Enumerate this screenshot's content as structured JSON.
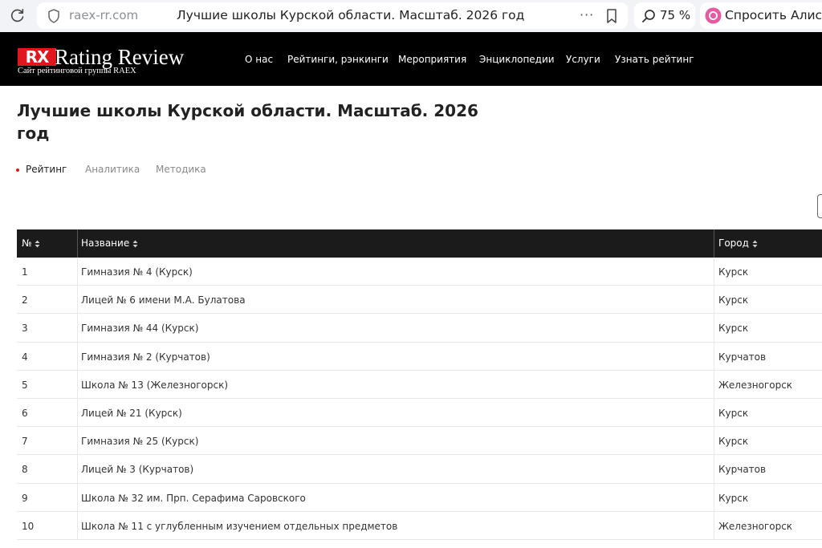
{
  "browser": {
    "url": "raex-rr.com",
    "tab_title": "Лучшие школы Курской области. Масштаб. 2026 год",
    "more_label": "···",
    "zoom": "75 %",
    "alice_label": "Спросить Алису"
  },
  "site": {
    "logo_mark": "RX",
    "logo_name": "Rating Review",
    "logo_subtitle": "Сайт рейтинговой группы RAEX",
    "nav": [
      "О нас",
      "Рейтинги, рэнкинги",
      "Мероприятия",
      "Энциклопедии",
      "Услуги",
      "Узнать рейтинг"
    ]
  },
  "page": {
    "title_line1": "Лучшие школы Курской области. Масштаб. 2026",
    "title_line2": "год",
    "tabs": [
      "Рейтинг",
      "Аналитика",
      "Методика"
    ]
  },
  "table": {
    "columns": [
      "№",
      "Название",
      "Город"
    ],
    "rows": [
      [
        "1",
        "Гимназия № 4 (Курск)",
        "Курск"
      ],
      [
        "2",
        "Лицей № 6 имени М.А. Булатова",
        "Курск"
      ],
      [
        "3",
        "Гимназия № 44 (Курск)",
        "Курск"
      ],
      [
        "4",
        "Гимназия № 2 (Курчатов)",
        "Курчатов"
      ],
      [
        "5",
        "Школа № 13 (Железногорск)",
        "Железногорск"
      ],
      [
        "6",
        "Лицей № 21 (Курск)",
        "Курск"
      ],
      [
        "7",
        "Гимназия № 25 (Курск)",
        "Курск"
      ],
      [
        "8",
        "Лицей № 3 (Курчатов)",
        "Курчатов"
      ],
      [
        "9",
        "Школа № 32 им. Прп. Серафима Саровского",
        "Курск"
      ],
      [
        "10",
        "Школа № 11 с углубленным изучением отдельных предметов",
        "Железногорск"
      ]
    ]
  },
  "colors": {
    "brand_red": "#e0171e",
    "header_bg": "#000000",
    "table_header_bg": "#1b1b1b",
    "alice_purple": "#e85aa0"
  },
  "icons": [
    "reload-icon",
    "shield-icon",
    "bookmark-icon",
    "zoom-search-icon",
    "alice-icon",
    "sort-icon"
  ]
}
